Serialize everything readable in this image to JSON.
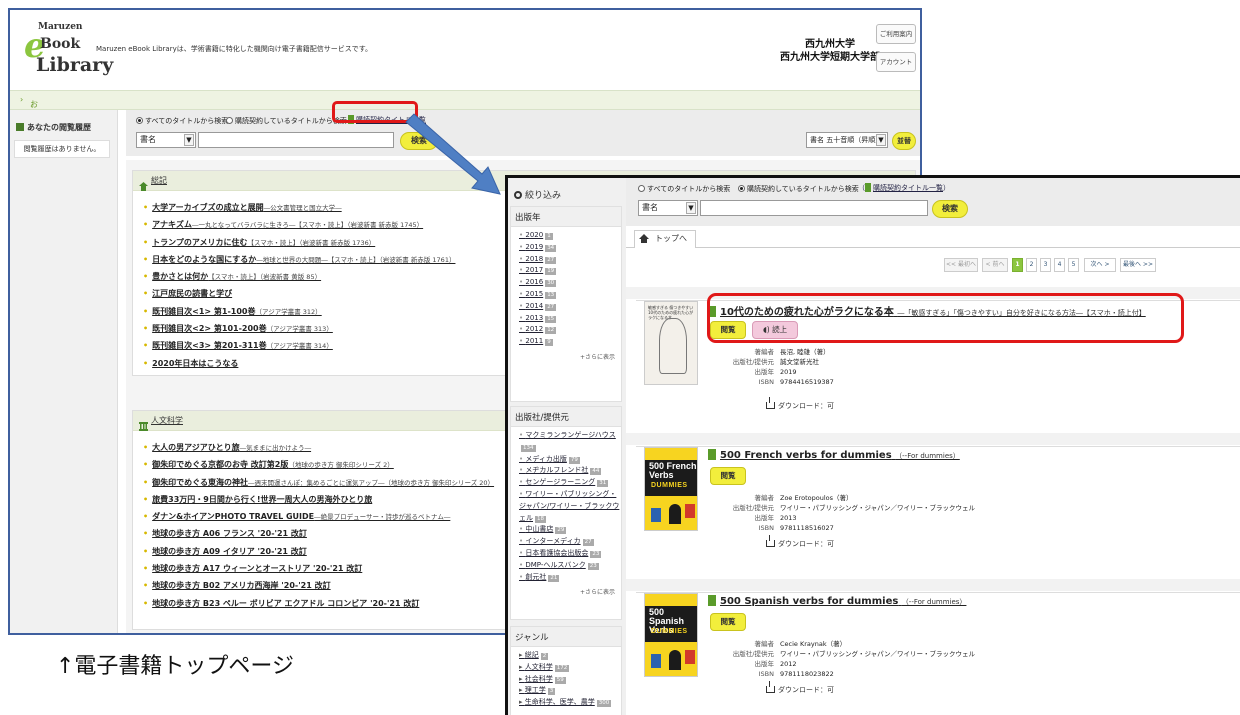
{
  "top_page": {
    "logo": {
      "line1": "Maruzen",
      "line2": "eBook",
      "line3": "Library"
    },
    "tagline": "Maruzen eBook Libraryは、学術書籍に特化した機関向け電子書籍配信サービスです。",
    "university": [
      "西九州大学",
      "西九州大学短期大学部"
    ],
    "help_button": "ご利用案内",
    "account_button": "アカウント",
    "notice": "お知らせ",
    "history_title": "あなたの閲覧履歴",
    "history_empty": "閲覧履歴はありません。",
    "search": {
      "radio_all": "すべてのタイトルから検索",
      "radio_subscribed": "購読契約しているタイトルから検索",
      "subscribed_list_link": "購読契約タイトル一覧",
      "field_select": "書名",
      "search_button": "検索",
      "sort_select": "書名 五十音順（昇順）",
      "sort_button": "並替"
    },
    "panels": [
      {
        "title": "総記",
        "items": [
          {
            "main": "大学アーカイブズの成立と展開",
            "sub": "―公文書管理と国立大学―"
          },
          {
            "main": "アナキズム",
            "sub": "―一丸となってバラバラに生きろ―【スマホ・読上】（岩波新書 新赤版 1745）"
          },
          {
            "main": "トランプのアメリカに住む",
            "sub": "【スマホ・読上】（岩波新書 新赤版 1736）"
          },
          {
            "main": "日本をどのような国にするか",
            "sub": "―地球と世界の大問題―【スマホ・読上】（岩波新書 新赤版 1761）"
          },
          {
            "main": "豊かさとは何か",
            "sub": "【スマホ・読上】（岩波新書 黄版 85）"
          },
          {
            "main": "江戸庶民の読書と学び",
            "sub": ""
          },
          {
            "main": "既刊雑目次<1> 第1-100巻",
            "sub": "（アジア学叢書 312）"
          },
          {
            "main": "既刊雑目次<2> 第101-200巻",
            "sub": "（アジア学叢書 313）"
          },
          {
            "main": "既刊雑目次<3> 第201-311巻",
            "sub": "（アジア学叢書 314）"
          },
          {
            "main": "2020年日本はこうなる",
            "sub": ""
          }
        ]
      },
      {
        "title": "人文科学",
        "items": [
          {
            "main": "大人の男アジアひとり旅",
            "sub": "―気ままに出かけよう―"
          },
          {
            "main": "御朱印でめぐる京都のお寺 改訂第2版",
            "sub": "（地球の歩き方 御朱印シリーズ 2）"
          },
          {
            "main": "御朱印でめぐる東海の神社",
            "sub": "―週末開運さんぽ：集めるごとに運気アップ―（地球の歩き方 御朱印シリーズ 20）"
          },
          {
            "main": "旅費33万円・9日間から行く!世界一周大人の男海外ひとり旅",
            "sub": ""
          },
          {
            "main": "ダナン&ホイアンPHOTO TRAVEL GUIDE",
            "sub": "―絶景プロデューサー・詩歩が巡るベトナム―"
          },
          {
            "main": "地球の歩き方 A06 フランス '20-'21 改訂",
            "sub": ""
          },
          {
            "main": "地球の歩き方 A09 イタリア '20-'21 改訂",
            "sub": ""
          },
          {
            "main": "地球の歩き方 A17 ウィーンとオーストリア '20-'21 改訂",
            "sub": ""
          },
          {
            "main": "地球の歩き方 B02 アメリカ西海岸 '20-'21 改訂",
            "sub": ""
          },
          {
            "main": "地球の歩き方 B23 ペルー ボリビア エクアドル コロンビア '20-'21 改訂",
            "sub": ""
          }
        ]
      }
    ]
  },
  "caption": "↑電子書籍トップページ",
  "results_page": {
    "narrow_label": "絞り込み",
    "facets": {
      "year": {
        "title": "出版年",
        "items": [
          {
            "label": "2020",
            "count": "1"
          },
          {
            "label": "2019",
            "count": "34"
          },
          {
            "label": "2018",
            "count": "27"
          },
          {
            "label": "2017",
            "count": "19"
          },
          {
            "label": "2016",
            "count": "30"
          },
          {
            "label": "2015",
            "count": "13"
          },
          {
            "label": "2014",
            "count": "27"
          },
          {
            "label": "2013",
            "count": "15"
          },
          {
            "label": "2012",
            "count": "12"
          },
          {
            "label": "2011",
            "count": "9"
          }
        ],
        "more": "+さらに表示"
      },
      "publisher": {
        "title": "出版社/提供元",
        "items": [
          {
            "label": "マクミランランゲージハウス",
            "count": "134"
          },
          {
            "label": "メディカ出版",
            "count": "79"
          },
          {
            "label": "メヂカルフレンド社",
            "count": "44"
          },
          {
            "label": "センゲージラーニング",
            "count": "31"
          },
          {
            "label": "ワイリー・パブリッシング・ジャパン/ワイリー・ブラックウェル",
            "count": "18"
          },
          {
            "label": "中山書店",
            "count": "29"
          },
          {
            "label": "インターメディカ",
            "count": "27"
          },
          {
            "label": "日本看護協会出版会",
            "count": "23"
          },
          {
            "label": "DMP-ヘルスバンク",
            "count": "23"
          },
          {
            "label": "創元社",
            "count": "21"
          }
        ],
        "more": "+さらに表示"
      },
      "genre": {
        "title": "ジャンル",
        "items": [
          {
            "label": "総記",
            "count": "2"
          },
          {
            "label": "人文科学",
            "count": "172"
          },
          {
            "label": "社会科学",
            "count": "59"
          },
          {
            "label": "理工学",
            "count": "3"
          },
          {
            "label": "生命科学、医学、農学",
            "count": "300"
          }
        ]
      }
    },
    "search": {
      "radio_all": "すべてのタイトルから検索",
      "radio_subscribed": "購読契約しているタイトルから検索",
      "subscribed_list_link": "購読契約タイトル一覧",
      "field_select": "書名",
      "search_button": "検索"
    },
    "top_link": "トップへ",
    "pager": {
      "first": "<< 最初へ",
      "prev": "< 前へ",
      "pages": [
        "1",
        "2",
        "3",
        "4",
        "5"
      ],
      "current": "1",
      "next": "次へ >",
      "last": "最後へ >>"
    },
    "results": [
      {
        "title": "10代のための疲れた心がラクになる本",
        "subtitle": "―「敏感すぎる」「傷つきやすい」自分を好きになる方法―【スマホ・読上付】",
        "browse": "閲覧",
        "readup": "読上",
        "author": "長沼, 睦雄（著）",
        "publisher": "誠文堂新光社",
        "year": "2019",
        "isbn": "9784416519387",
        "download": "ダウンロード：可",
        "cover_text": "敏感すぎる 傷つきやすい 10代のための疲れた心がラクになる本"
      },
      {
        "title": "500 French verbs for dummies",
        "subtitle": "（--For dummies）",
        "browse": "閲覧",
        "author": "Zoe Erotopoulos（著）",
        "publisher": "ワイリー・パブリッシング・ジャパン／ワイリー・ブラックウェル",
        "year": "2013",
        "isbn": "9781118516027",
        "download": "ダウンロード：可",
        "cover_text": "500 French Verbs",
        "cover_brand": "DUMMIES"
      },
      {
        "title": "500 Spanish verbs for dummies",
        "subtitle": "（--For dummies）",
        "browse": "閲覧",
        "author": "Cecie Kraynak（著）",
        "publisher": "ワイリー・パブリッシング・ジャパン／ワイリー・ブラックウェル",
        "year": "2012",
        "isbn": "9781118023822",
        "download": "ダウンロード：可",
        "cover_text": "500 Spanish Verbs",
        "cover_brand": "DUMMIES"
      }
    ],
    "meta_labels": {
      "author": "著編者",
      "publisher": "出版社/提供元",
      "year": "出版年",
      "isbn": "ISBN"
    }
  },
  "colors": {
    "highlight": "#e01818",
    "arrow": "#4f7fc4",
    "brand_green": "#8cc63f",
    "button_yellow": "#f2ee3c"
  }
}
